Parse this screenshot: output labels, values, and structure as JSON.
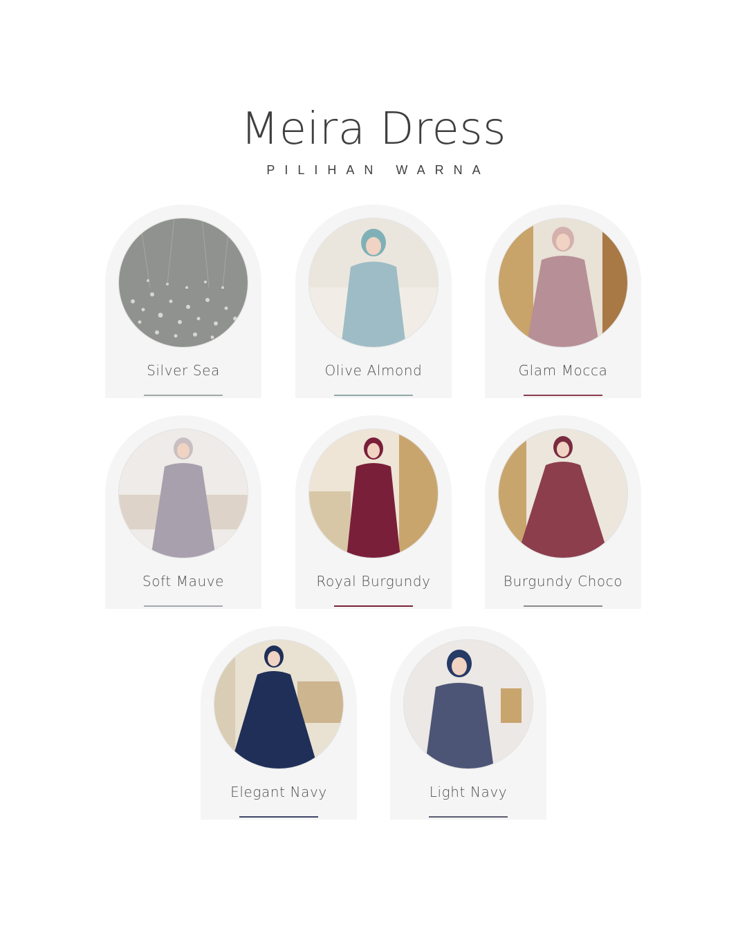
{
  "header": {
    "title": "Meira Dress",
    "subtitle": "PILIHAN WARNA"
  },
  "variants": [
    {
      "name": "Silver Sea",
      "swatch": "#9eaaa6",
      "bg": "#8f928e",
      "dress": "#c9c9c4",
      "icon": "sequin-texture-photo"
    },
    {
      "name": "Olive Almond",
      "swatch": "#8faaa6",
      "bg": "#e8e2d8",
      "dress": "#9dbcc6",
      "icon": "model-photo"
    },
    {
      "name": "Glam Mocca",
      "swatch": "#8a3b4c",
      "bg": "#c8a36a",
      "dress": "#b78f96",
      "icon": "model-photo"
    },
    {
      "name": "Soft Mauve",
      "swatch": "#a4a7b0",
      "bg": "#ece9e6",
      "dress": "#a8a0ad",
      "icon": "model-photo"
    },
    {
      "name": "Royal Burgundy",
      "swatch": "#7b2336",
      "bg": "#c9a56e",
      "dress": "#7a1f3a",
      "icon": "model-photo"
    },
    {
      "name": "Burgundy Choco",
      "swatch": "#8a8a8a",
      "bg": "#d8c7a7",
      "dress": "#8c3e4d",
      "icon": "model-photo"
    },
    {
      "name": "Elegant Navy",
      "swatch": "#3d4668",
      "bg": "#cdb58f",
      "dress": "#1f2f58",
      "icon": "model-photo"
    },
    {
      "name": "Light Navy",
      "swatch": "#5a5c6e",
      "bg": "#e7e4e2",
      "dress": "#4d5576",
      "icon": "model-photo"
    }
  ]
}
